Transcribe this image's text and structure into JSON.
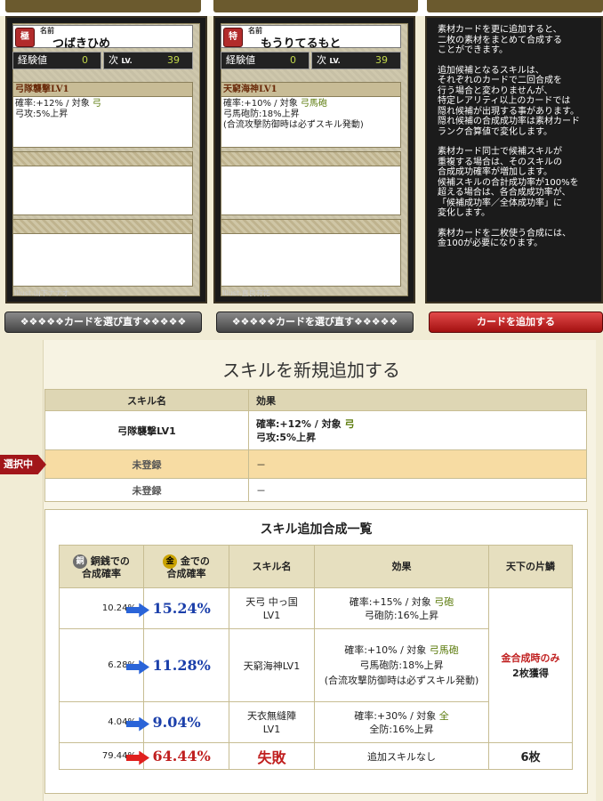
{
  "top_cards": [
    {
      "rank": "極",
      "name_label": "名前",
      "name": "つばきひめ",
      "exp_label": "経験値",
      "exp_value": "0",
      "next_label": "次",
      "lv_label": "LV.",
      "next_value": "39",
      "skills": [
        {
          "title": "弓隊襲撃LV1",
          "desc_parts": [
            "確率:+12% / 対象 ",
            "弓",
            "弓攻:5%上昇"
          ]
        },
        {
          "title": "",
          "desc_parts": [
            "",
            "",
            ""
          ]
        },
        {
          "title": "",
          "desc_parts": [
            "",
            "",
            ""
          ]
        }
      ],
      "illust": "Illust.山下ナナオ"
    },
    {
      "rank": "特",
      "name_label": "名前",
      "name": "もうりてるもと",
      "exp_label": "経験値",
      "exp_value": "0",
      "next_label": "次",
      "lv_label": "LV.",
      "next_value": "39",
      "skills": [
        {
          "title": "天窮海神LV1",
          "line1_pre": "確率:+10% / 対象 ",
          "line1_hl": "弓馬砲",
          "line2": "弓馬砲防:18%上昇",
          "line3": "(合流攻撃防御時は必ずスキル発動)"
        },
        {
          "title": ""
        },
        {
          "title": ""
        }
      ],
      "illust": "Illust.直良有祐"
    }
  ],
  "info_text": [
    "素材カードを更に追加すると、\n二枚の素材をまとめて合成する\nことができます。",
    "追加候補となるスキルは、\nそれぞれのカードで二回合成を\n行う場合と変わりませんが、\n特定レアリティ以上のカードでは\n隠れ候補が出現する事があります。\n隠れ候補の合成成功率は素材カード\nランク合算値で変化します。",
    "素材カード同士で候補スキルが\n重複する場合は、そのスキルの\n合成成功確率が増加します。\n候補スキルの合計成功率が100%を\n超える場合は、各合成成功率が、\n「候補成功率／全体成功率」に\n変化します。",
    "素材カードを二枚使う合成には、\n金100が必要になります。"
  ],
  "buttons": {
    "reselect_1": "❖❖❖❖❖カードを選び直す❖❖❖❖❖",
    "reselect_2": "❖❖❖❖❖カードを選び直す❖❖❖❖❖",
    "add_card": "カードを追加する"
  },
  "skill_add": {
    "title": "スキルを新規追加する",
    "headers": [
      "スキル名",
      "効果"
    ],
    "rows": [
      {
        "name": "弓隊襲撃LV1",
        "effect_pre": "確率:+12% / 対象 ",
        "effect_hl": "弓",
        "effect_line2": "弓攻:5%上昇"
      },
      {
        "name": "未登録",
        "effect": "－"
      },
      {
        "name": "未登録",
        "effect": "－"
      }
    ],
    "selected_tag": "選択中"
  },
  "combo": {
    "title": "スキル追加合成一覧",
    "headers": {
      "copper_coin": "銅",
      "copper_line1": "銅銭での",
      "copper_line2": "合成確率",
      "gold_coin": "金",
      "gold_line1": "金での",
      "gold_line2": "合成確率",
      "skill": "スキル名",
      "effect": "効果",
      "shard": "天下の片鱗"
    },
    "rows": [
      {
        "copper": "10.24%",
        "gold": "15.24%",
        "skill1": "天弓 中っ国",
        "skill2": "LV1",
        "eff1_pre": "確率:+15% / 対象 ",
        "eff1_hl": "弓砲",
        "eff2": "弓砲防:16%上昇",
        "eff3": ""
      },
      {
        "copper": "6.28%",
        "gold": "11.28%",
        "skill1": "天窮海神LV1",
        "skill2": "",
        "eff1_pre": "確率:+10% / 対象 ",
        "eff1_hl": "弓馬砲",
        "eff2": "弓馬砲防:18%上昇",
        "eff3": "(合流攻撃防御時は必ずスキル発動)"
      },
      {
        "copper": "4.04%",
        "gold": "9.04%",
        "skill1": "天衣無縫陣",
        "skill2": "LV1",
        "eff1_pre": "確率:+30% / 対象 ",
        "eff1_hl": "全",
        "eff2": "全防:16%上昇",
        "eff3": ""
      },
      {
        "copper": "79.44%",
        "gold": "64.44%",
        "skill1": "失敗",
        "skill2": "",
        "eff1_pre": "追加スキルなし",
        "eff1_hl": "",
        "eff2": "",
        "eff3": ""
      }
    ],
    "shard_note1": "金合成時のみ",
    "shard_note2": "2枚獲得",
    "shard_fail": "6枚"
  }
}
